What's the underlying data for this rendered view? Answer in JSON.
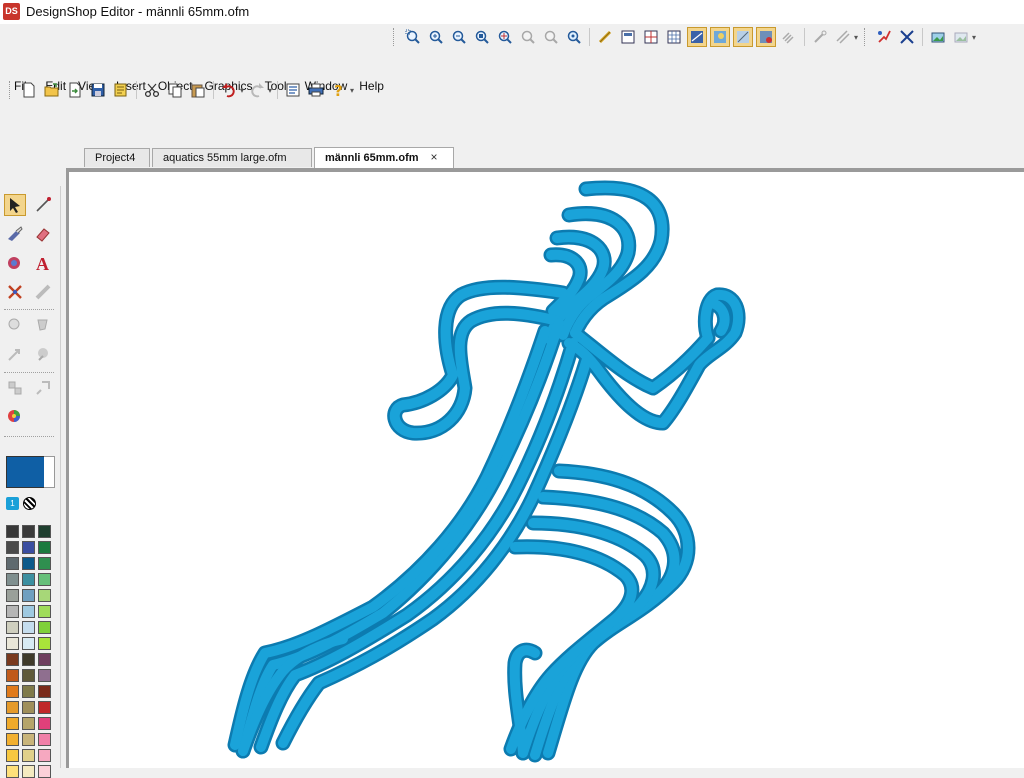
{
  "window": {
    "title": "DesignShop Editor - männli 65mm.ofm",
    "logo_text": "DS"
  },
  "menu": [
    "File",
    "Edit",
    "View",
    "Insert",
    "Object",
    "Graphics",
    "Tools",
    "Window",
    "Help"
  ],
  "tabs": [
    {
      "label": "Project4",
      "active": false
    },
    {
      "label": "aquatics 55mm large.ofm",
      "active": false
    },
    {
      "label": "männli 65mm.ofm",
      "active": true,
      "close": "×"
    }
  ],
  "standard_toolbar": [
    "new-icon",
    "open-icon",
    "import-icon",
    "save-icon",
    "save-as-icon",
    "cut-icon",
    "copy-icon",
    "paste-icon",
    "undo-icon",
    "redo-icon",
    "properties-icon",
    "print-icon",
    "help-icon"
  ],
  "zoom_toolbar": [
    "zoom-window-icon",
    "zoom-in-icon",
    "zoom-out-icon",
    "zoom-100-icon",
    "zoom-fit-icon",
    "zoom-previous-icon",
    "zoom-next-icon",
    "zoom-all-icon"
  ],
  "view_toolbar": [
    "measure-icon",
    "view-grid-icon",
    "view-cross-icon",
    "view-table-icon",
    "view-realistic-icon",
    "view-stitches-icon",
    "view-outline-icon",
    "view-jumps-icon",
    "view-hatch-icon"
  ],
  "extra_toolbar": [
    "needle-icon",
    "hoop-icon",
    "split-icon",
    "reposition-icon",
    "picture-icon",
    "picture-2-icon"
  ],
  "palette_tools": [
    "select-icon",
    "line-icon",
    "knife-icon",
    "eraser-icon",
    "fill-icon",
    "text-icon",
    "magic-icon",
    "transform-icon",
    "group-icon",
    "ungroup-icon",
    "align-icon",
    "distribute-icon",
    "shape-icon",
    "node-icon",
    "color-wheel-icon"
  ],
  "current_color": {
    "number": "1",
    "hex": "#0f5fa5"
  },
  "swatches": [
    "#383838",
    "#3a3a3a",
    "#1f3f2f",
    "#4a4a4a",
    "#3b4ea0",
    "#1b7a3e",
    "#5f6a6f",
    "#0c5a8a",
    "#2f8f4f",
    "#7f8f8f",
    "#3c8fa0",
    "#66c07a",
    "#9aa09a",
    "#6f9fc0",
    "#a7d778",
    "#b5b5b5",
    "#9fc9e0",
    "#9fdc5a",
    "#cfcfbf",
    "#c5ddee",
    "#7fd03a",
    "#e9e6d8",
    "#d8ebf4",
    "#a9e43a",
    "#7a3a1f",
    "#3f3a2a",
    "#6f3f5f",
    "#c05a1a",
    "#5f5a3a",
    "#8f6f8f",
    "#e07a1a",
    "#7f7a4a",
    "#7a2a1a",
    "#e59a2a",
    "#9f8f5a",
    "#c0282a",
    "#f0aa2a",
    "#b5a56a",
    "#e0407a",
    "#f2b030",
    "#c8b47a",
    "#f080a8",
    "#f7c840",
    "#e0d08a",
    "#f6a8c0",
    "#ffe07a",
    "#f4eac0",
    "#fcd0d8"
  ],
  "colors": {
    "thread": "#1aa3d9",
    "thread_shadow": "#0c7bb0"
  }
}
